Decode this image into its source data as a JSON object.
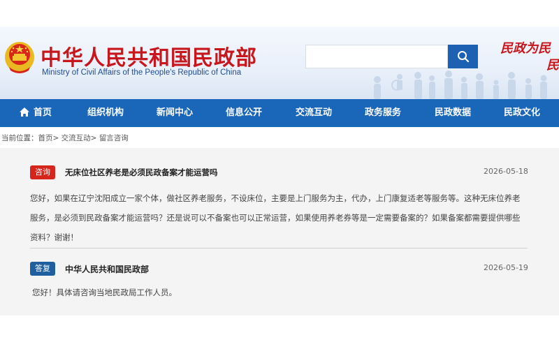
{
  "header": {
    "title": "中华人民共和国民政部",
    "subtitle": "Ministry of Civil Affairs of the People's Republic of China",
    "slogan_line1": "民政为民",
    "slogan_line2": "民",
    "emblem_icon": "national-emblem-icon",
    "search": {
      "value": "",
      "placeholder": "",
      "button_icon": "search-icon"
    }
  },
  "nav": {
    "home": "首页",
    "items": [
      "组织机构",
      "新闻中心",
      "信息公开",
      "交流互动",
      "政务服务",
      "民政数据",
      "民政文化"
    ]
  },
  "breadcrumb": {
    "label": "当前位置：",
    "items": [
      "首页",
      "交流互动",
      "留言咨询"
    ],
    "separator": ">"
  },
  "question": {
    "tag": "咨询",
    "title": "无床位社区养老是必须民政备案才能运营吗",
    "date": "2026-05-18",
    "body": "您好，如果在辽宁沈阳成立一家个体，做社区养老服务，不设床位，主要是上门服务为主，代办，上门康复适老等服务等。这种无床位养老服务，是必须到民政备案才能运营吗？还是说可以不备案也可以正常运营，如果使用养老券等是一定需要备案的？如果备案都需要提供哪些资料？谢谢！"
  },
  "answer": {
    "tag": "答复",
    "org": "中华人民共和国民政部",
    "date": "2026-05-19",
    "body": "您好！具体请咨询当地民政局工作人员。"
  },
  "colors": {
    "brand_red": "#c8161d",
    "nav_blue": "#1a66b8",
    "search_blue": "#1d62b2",
    "ask_tag": "#d6261c",
    "answer_tag": "#1f5f9f"
  }
}
